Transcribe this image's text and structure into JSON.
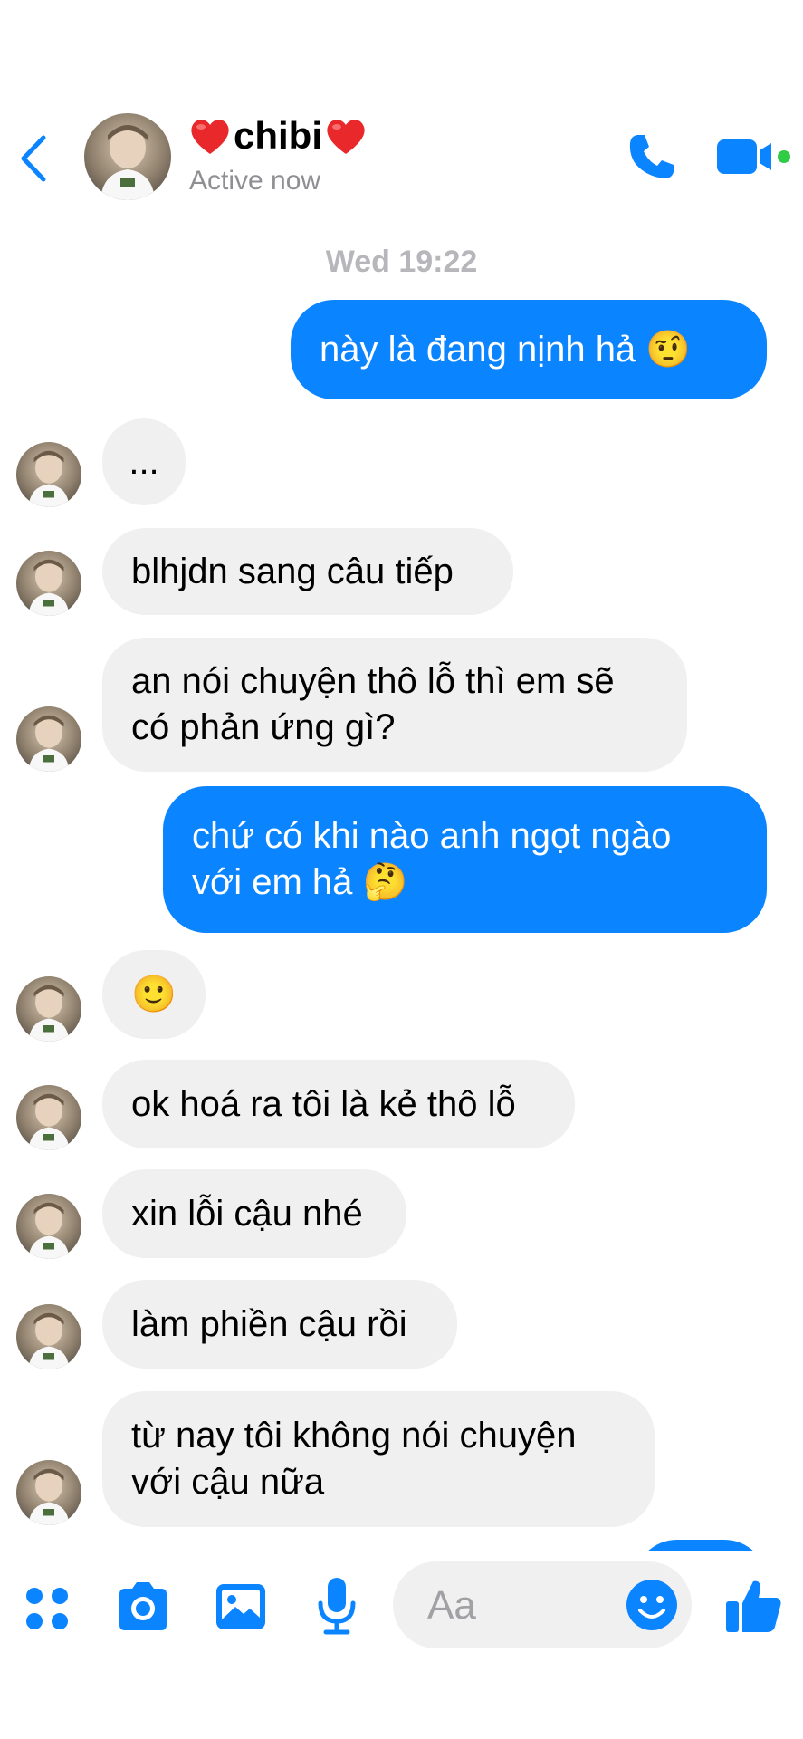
{
  "header": {
    "contact_name": "chibi",
    "status": "Active now"
  },
  "chat": {
    "timestamp": "Wed 19:22",
    "messages": [
      {
        "from": "me",
        "text": "này là đang nịnh hả 🤨"
      },
      {
        "from": "contact",
        "text": "..."
      },
      {
        "from": "contact",
        "text": "blhjdn sang câu tiếp"
      },
      {
        "from": "contact",
        "text": "an nói chuyện thô lỗ thì em sẽ\ncó phản ứng gì?"
      },
      {
        "from": "me",
        "text": "chứ có khi nào anh ngọt ngào\nvới em hả 🤔"
      },
      {
        "from": "contact",
        "text": "🙂"
      },
      {
        "from": "contact",
        "text": "ok hoá ra tôi là kẻ thô lỗ"
      },
      {
        "from": "contact",
        "text": "xin lỗi cậu nhé"
      },
      {
        "from": "contact",
        "text": "làm phiền cậu rồi"
      },
      {
        "from": "contact",
        "text": "từ nay tôi không nói chuyện\nvới cậu nữa"
      }
    ]
  },
  "composer": {
    "placeholder": "Aa"
  },
  "colors": {
    "accent": "#0a84ff",
    "incoming_bubble": "#f0f0f0",
    "online": "#31cc46",
    "timestamp": "#b6b6bb"
  },
  "icons": [
    "chevron-left-icon",
    "heart-icon",
    "phone-icon",
    "video-camera-icon",
    "apps-grid-icon",
    "camera-icon",
    "photo-icon",
    "microphone-icon",
    "emoji-icon",
    "thumbs-up-icon"
  ]
}
